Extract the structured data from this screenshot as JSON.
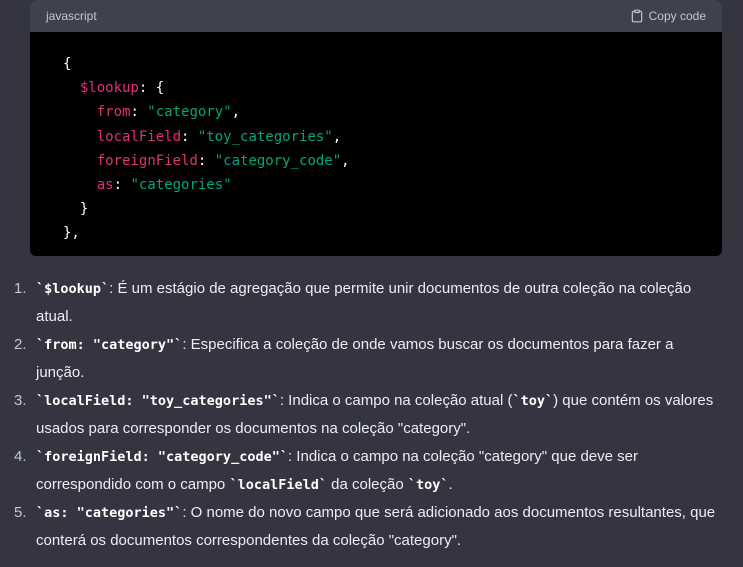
{
  "code_block": {
    "language": "javascript",
    "copy_label": "Copy code",
    "lines": [
      [
        {
          "t": "{",
          "c": "pl"
        }
      ],
      [
        {
          "t": "  ",
          "c": "pl"
        },
        {
          "t": "$lookup",
          "c": "kw"
        },
        {
          "t": ": {",
          "c": "pl"
        }
      ],
      [
        {
          "t": "    ",
          "c": "pl"
        },
        {
          "t": "from",
          "c": "kw"
        },
        {
          "t": ": ",
          "c": "pl"
        },
        {
          "t": "\"category\"",
          "c": "str"
        },
        {
          "t": ",",
          "c": "pl"
        }
      ],
      [
        {
          "t": "    ",
          "c": "pl"
        },
        {
          "t": "localField",
          "c": "kw"
        },
        {
          "t": ": ",
          "c": "pl"
        },
        {
          "t": "\"toy_categories\"",
          "c": "str"
        },
        {
          "t": ",",
          "c": "pl"
        }
      ],
      [
        {
          "t": "    ",
          "c": "pl"
        },
        {
          "t": "foreignField",
          "c": "kw"
        },
        {
          "t": ": ",
          "c": "pl"
        },
        {
          "t": "\"category_code\"",
          "c": "str"
        },
        {
          "t": ",",
          "c": "pl"
        }
      ],
      [
        {
          "t": "    ",
          "c": "pl"
        },
        {
          "t": "as",
          "c": "kw"
        },
        {
          "t": ": ",
          "c": "pl"
        },
        {
          "t": "\"categories\"",
          "c": "str"
        }
      ],
      [
        {
          "t": "  }",
          "c": "pl"
        }
      ],
      [
        {
          "t": "},",
          "c": "pl"
        }
      ]
    ]
  },
  "explanations": [
    {
      "number": "1.",
      "parts": [
        {
          "t": "`$lookup`",
          "code": true
        },
        {
          "t": ": É um estágio de agregação que permite unir documentos de outra coleção na coleção atual.",
          "code": false
        }
      ]
    },
    {
      "number": "2.",
      "parts": [
        {
          "t": "`from: \"category\"`",
          "code": true
        },
        {
          "t": ": Especifica a coleção de onde vamos buscar os documentos para fazer a junção.",
          "code": false
        }
      ]
    },
    {
      "number": "3.",
      "parts": [
        {
          "t": "`localField: \"toy_categories\"`",
          "code": true
        },
        {
          "t": ": Indica o campo na coleção atual (",
          "code": false
        },
        {
          "t": "`toy`",
          "code": true
        },
        {
          "t": ") que contém os valores usados para corresponder os documentos na coleção \"category\".",
          "code": false
        }
      ]
    },
    {
      "number": "4.",
      "parts": [
        {
          "t": "`foreignField: \"category_code\"`",
          "code": true
        },
        {
          "t": ": Indica o campo na coleção \"category\" que deve ser correspondido com o campo ",
          "code": false
        },
        {
          "t": "`localField`",
          "code": true
        },
        {
          "t": " da coleção ",
          "code": false
        },
        {
          "t": "`toy`",
          "code": true
        },
        {
          "t": ".",
          "code": false
        }
      ]
    },
    {
      "number": "5.",
      "parts": [
        {
          "t": "`as: \"categories\"`",
          "code": true
        },
        {
          "t": ": O nome do novo campo que será adicionado aos documentos resultantes, que conterá os documentos correspondentes da coleção \"category\".",
          "code": false
        }
      ]
    }
  ]
}
